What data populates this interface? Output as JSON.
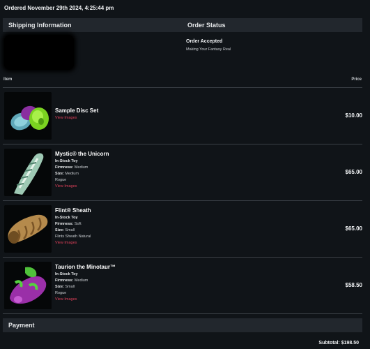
{
  "order": {
    "date_text": "Ordered November 29th 2024, 4:25:44 pm"
  },
  "sections": {
    "shipping_title": "Shipping Information",
    "status_title": "Order Status",
    "payment_title": "Payment"
  },
  "status": {
    "title": "Order Accepted",
    "subtitle": "Making Your Fantasy Real"
  },
  "table": {
    "item_header": "Item",
    "price_header": "Price"
  },
  "items": [
    {
      "name": "Sample Disc Set",
      "type": "",
      "firmness": "",
      "size": "",
      "color": "",
      "link": "View Images",
      "price": "$10.00",
      "image_icon": "disc-set-image"
    },
    {
      "name": "Mystic® the Unicorn",
      "type": "In-Stock Toy",
      "firmness_label": "Firmness:",
      "firmness": "Medium",
      "size_label": "Size:",
      "size": "Medium",
      "color": "Rogue",
      "link": "View Images",
      "price": "$65.00",
      "image_icon": "unicorn-toy-image"
    },
    {
      "name": "Flint® Sheath",
      "type": "In-Stock Toy",
      "firmness_label": "Firmness:",
      "firmness": "Soft",
      "size_label": "Size:",
      "size": "Small",
      "color": "Flints Sheath Natural",
      "link": "View Images",
      "price": "$65.00",
      "image_icon": "sheath-toy-image"
    },
    {
      "name": "Taurion the Minotaur™",
      "type": "In-Stock Toy",
      "firmness_label": "Firmness:",
      "firmness": "Medium",
      "size_label": "Size:",
      "size": "Small",
      "color": "Rogue",
      "link": "View Images",
      "price": "$58.50",
      "image_icon": "minotaur-toy-image"
    }
  ],
  "payment": {
    "subtotal_text": "Subtotal: $198.50"
  },
  "colors": {
    "background": "#101418",
    "header_bar": "#22272d",
    "link": "#e0405a"
  }
}
